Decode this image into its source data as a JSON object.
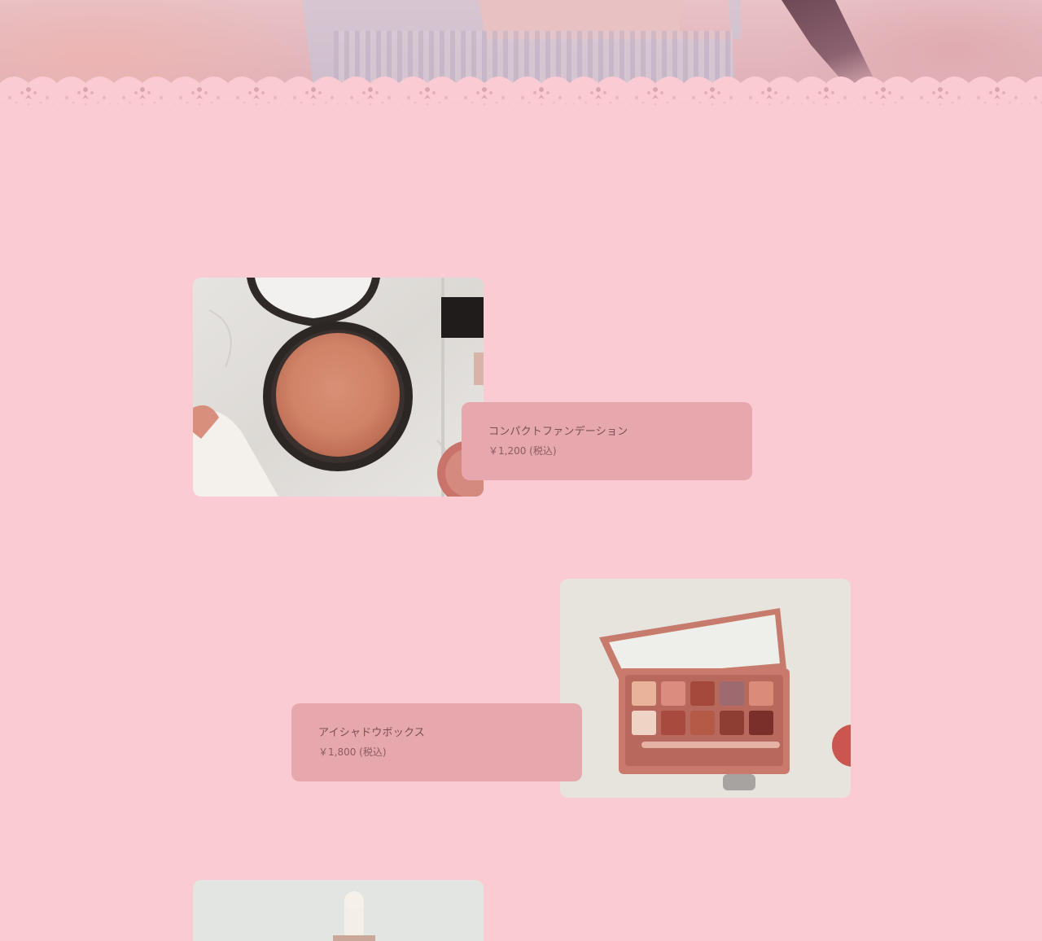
{
  "hero": {
    "image_icon": "woman-in-lavender-top-photo",
    "border_icon": "lace-trim-border"
  },
  "products": [
    {
      "name": "コンパクトファンデーション",
      "price": "￥1,200 (税込)",
      "image_icon": "compact-foundation-photo"
    },
    {
      "name": "アイシャドウボックス",
      "price": "￥1,800 (税込)",
      "image_icon": "eyeshadow-palette-photo"
    },
    {
      "image_icon": "serum-dropper-bottle-photo"
    }
  ],
  "colors": {
    "background": "#fbcbd4",
    "card": "#e6a8ad",
    "text": "#7a4f55"
  }
}
